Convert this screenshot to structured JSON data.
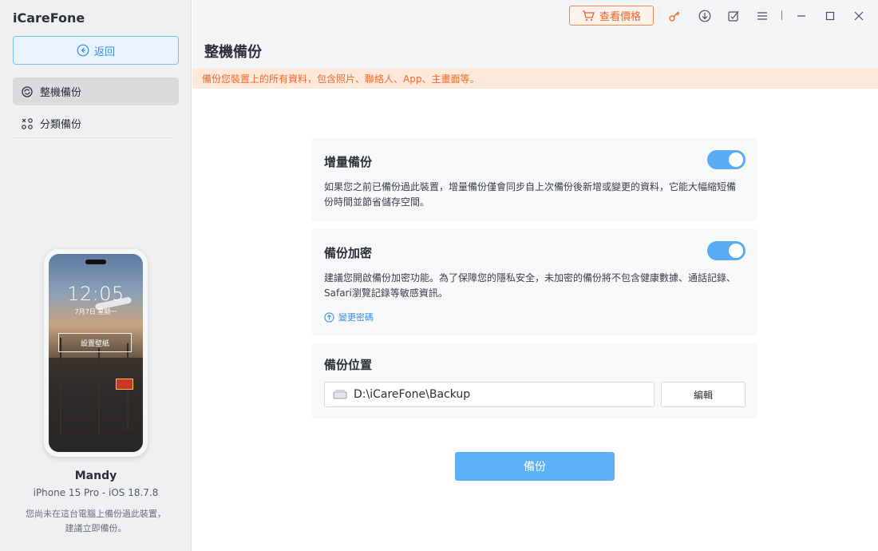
{
  "app": {
    "title": "iCareFone"
  },
  "sidebar": {
    "back_label": "返回",
    "items": [
      {
        "label": "整機備份",
        "active": true,
        "icon": "refresh-icon"
      },
      {
        "label": "分類備份",
        "active": false,
        "icon": "category-icon"
      }
    ]
  },
  "device": {
    "lock_time": "12:05",
    "lock_date": "7月7日 星期一",
    "wallpaper_button": "設置壁紙",
    "name": "Mandy",
    "model": "iPhone 15 Pro - iOS 18.7.8",
    "note_line1": "您尚未在這台電腦上備份過此裝置，",
    "note_line2": "建議立即備份。"
  },
  "toolbar": {
    "price_label": "查看價格",
    "icons": [
      "cart-icon",
      "key-icon",
      "download-icon",
      "feedback-icon",
      "menu-icon",
      "minimize-icon",
      "maximize-icon",
      "close-icon"
    ]
  },
  "page": {
    "title": "整機備份",
    "notice": "備份您裝置上的所有資料，包含照片、聯絡人、App、主畫面等。"
  },
  "incremental": {
    "title": "增量備份",
    "enabled": true,
    "desc": "如果您之前已備份過此裝置，增量備份僅會同步自上次備份後新增或變更的資料，它能大幅縮短備份時間並節省儲存空間。"
  },
  "encryption": {
    "title": "備份加密",
    "enabled": true,
    "desc": "建議您開啟備份加密功能。為了保障您的隱私安全，未加密的備份將不包含健康數據、通話記錄、Safari瀏覽記錄等敏感資訊。",
    "change_password": "變更密碼"
  },
  "location": {
    "title": "備份位置",
    "path": "D:\\iCareFone\\Backup",
    "edit_label": "編輯"
  },
  "actions": {
    "backup_label": "備份"
  },
  "colors": {
    "accent": "#5bb0f7",
    "orange": "#ef6a2a",
    "notice_bg": "#fde8dc"
  }
}
